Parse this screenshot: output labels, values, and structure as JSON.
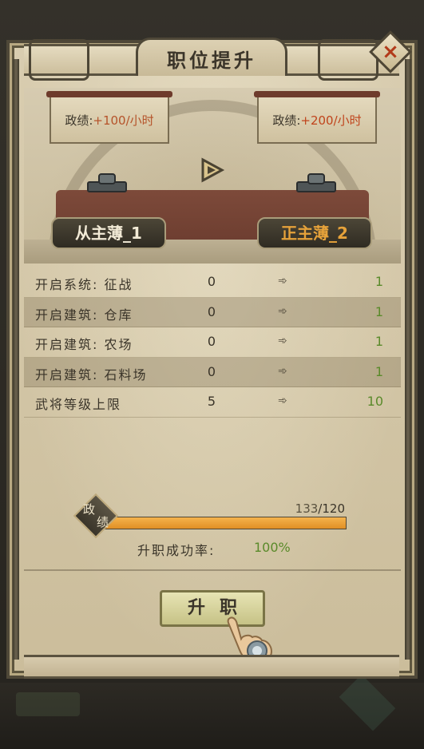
{
  "window": {
    "title": "职位提升",
    "close_symbol": "×"
  },
  "ranks": {
    "current": {
      "name": "从主薄_1",
      "output_label": "政绩:",
      "output_value": "+100/小时"
    },
    "next": {
      "name": "正主薄_2",
      "output_label": "政绩:",
      "output_value": "+200/小时"
    },
    "transition_icon": "triangle-arrow-icon"
  },
  "unlocks": {
    "rows": [
      {
        "label": "开启系统: 征战",
        "current": "0",
        "next": "1"
      },
      {
        "label": "开启建筑: 仓库",
        "current": "0",
        "next": "1"
      },
      {
        "label": "开启建筑: 农场",
        "current": "0",
        "next": "1"
      },
      {
        "label": "开启建筑: 石料场",
        "current": "0",
        "next": "1"
      },
      {
        "label": "武将等级上限",
        "current": "5",
        "next": "10"
      }
    ],
    "arrow_symbol": "➾"
  },
  "progress": {
    "badge_line1": "政",
    "badge_line2": "绩",
    "current": "133",
    "separator": "/",
    "max": "120",
    "fill_fraction": 1.0
  },
  "success": {
    "label": "升职成功率:",
    "value": "100%"
  },
  "actions": {
    "promote_label": "升职"
  },
  "colors": {
    "highlight_orange": "#c0441c",
    "success_green": "#5a8a2a",
    "rank_next_gold": "#e6a23a",
    "progress_fill": "#e08f25"
  }
}
